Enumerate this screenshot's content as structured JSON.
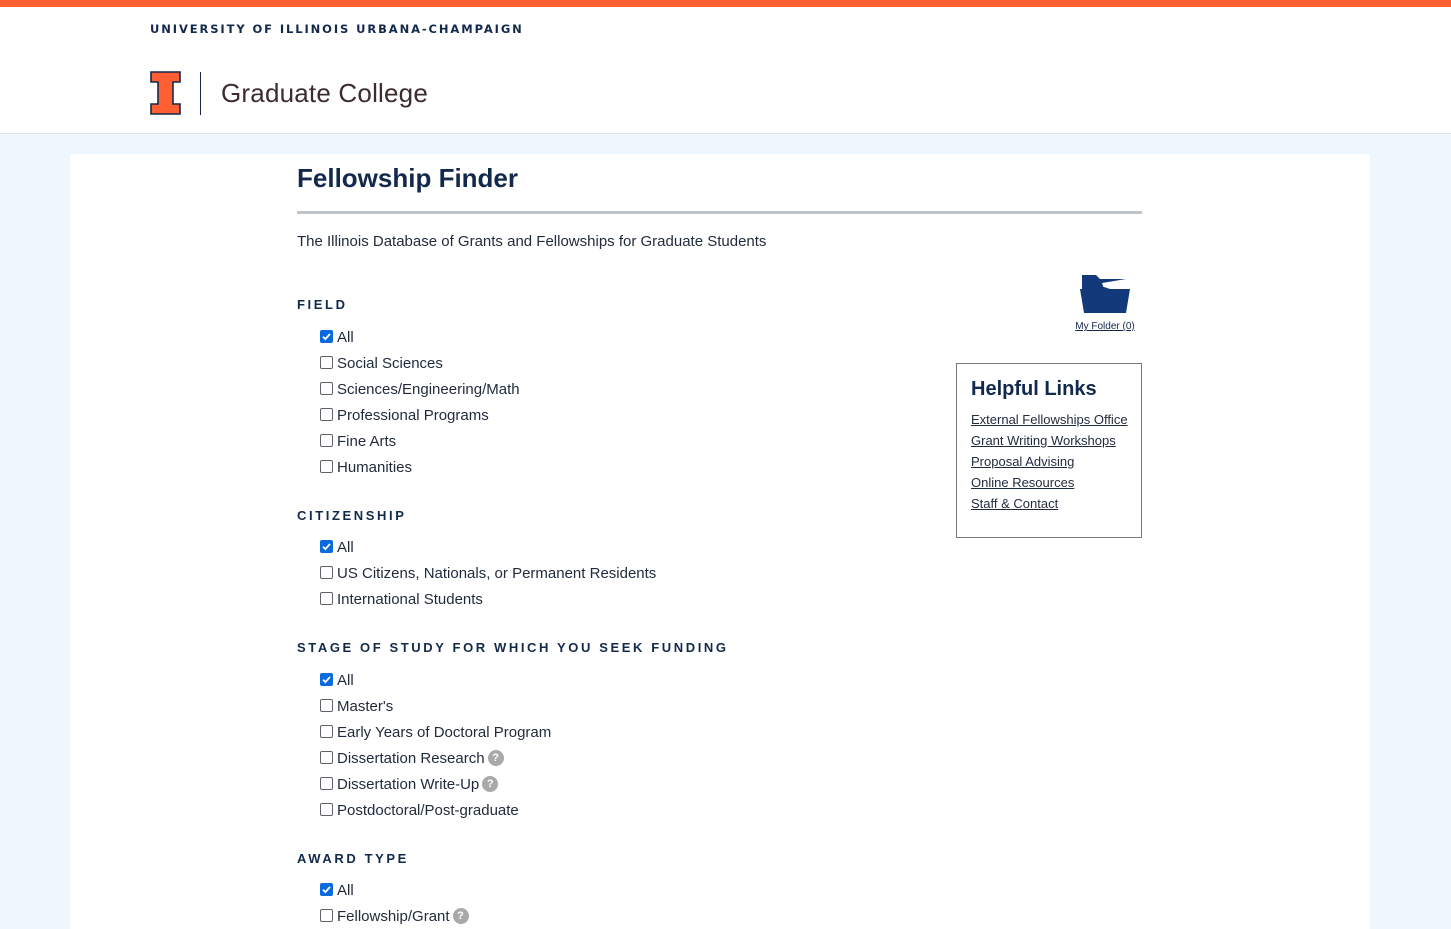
{
  "header": {
    "university": "UNIVERSITY OF ILLINOIS URBANA-CHAMPAIGN",
    "college": "Graduate College",
    "brand_orange": "#ff5f33",
    "brand_navy": "#13294b"
  },
  "page": {
    "title": "Fellowship Finder",
    "subtitle": "The Illinois Database of Grants and Fellowships for Graduate Students"
  },
  "folder": {
    "icon": "folder-open-icon",
    "label": "My Folder (0)"
  },
  "helpful_links": {
    "title": "Helpful Links",
    "links": [
      "External Fellowships Office",
      "Grant Writing Workshops",
      "Proposal Advising",
      "Online Resources",
      "Staff & Contact"
    ]
  },
  "filters": {
    "field": {
      "heading": "FIELD",
      "options": [
        {
          "label": "All",
          "checked": true
        },
        {
          "label": "Social Sciences",
          "checked": false
        },
        {
          "label": "Sciences/Engineering/Math",
          "checked": false
        },
        {
          "label": "Professional Programs",
          "checked": false
        },
        {
          "label": "Fine Arts",
          "checked": false
        },
        {
          "label": "Humanities",
          "checked": false
        }
      ]
    },
    "citizenship": {
      "heading": "CITIZENSHIP",
      "options": [
        {
          "label": "All",
          "checked": true
        },
        {
          "label": "US Citizens, Nationals, or Permanent Residents",
          "checked": false
        },
        {
          "label": "International Students",
          "checked": false
        }
      ]
    },
    "stage": {
      "heading": "STAGE OF STUDY FOR WHICH YOU SEEK FUNDING",
      "options": [
        {
          "label": "All",
          "checked": true
        },
        {
          "label": "Master's",
          "checked": false
        },
        {
          "label": "Early Years of Doctoral Program",
          "checked": false
        },
        {
          "label": "Dissertation Research",
          "checked": false,
          "help": true
        },
        {
          "label": "Dissertation Write-Up",
          "checked": false,
          "help": true
        },
        {
          "label": "Postdoctoral/Post-graduate",
          "checked": false
        }
      ]
    },
    "award_type": {
      "heading": "AWARD TYPE",
      "options": [
        {
          "label": "All",
          "checked": true
        },
        {
          "label": "Fellowship/Grant",
          "checked": false,
          "help": true
        }
      ]
    }
  },
  "help_glyph": "?"
}
